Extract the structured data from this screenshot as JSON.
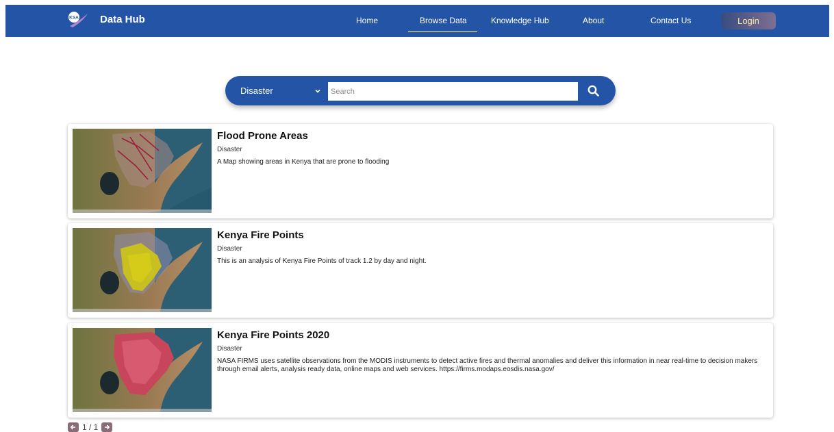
{
  "header": {
    "logo_text": "KSA",
    "brand": "Data Hub",
    "nav": [
      "Home",
      "Browse Data",
      "Knowledge Hub",
      "About",
      "Contact Us"
    ],
    "active_nav": "Browse Data",
    "login_label": "Login"
  },
  "search": {
    "category": "Disaster",
    "placeholder": "Search"
  },
  "results": [
    {
      "title": "Flood Prone Areas",
      "category": "Disaster",
      "description": "A Map showing areas in Kenya that are prone to flooding"
    },
    {
      "title": "Kenya Fire Points",
      "category": "Disaster",
      "description": "This is an analysis of Kenya Fire Points of track 1.2 by day and night."
    },
    {
      "title": "Kenya Fire Points 2020",
      "category": "Disaster",
      "description": "NASA FIRMS uses satellite observations from the MODIS instruments to detect active fires and thermal anomalies and deliver this information in near real-time to decision makers through email alerts, analysis ready data, online maps and web services. https://firms.modaps.eosdis.nasa.gov/"
    }
  ],
  "pagination": {
    "text": "1 / 1"
  },
  "colors": {
    "primary": "#2454a6",
    "pager": "#8a6b78",
    "login_text": "#ffe9a8"
  }
}
